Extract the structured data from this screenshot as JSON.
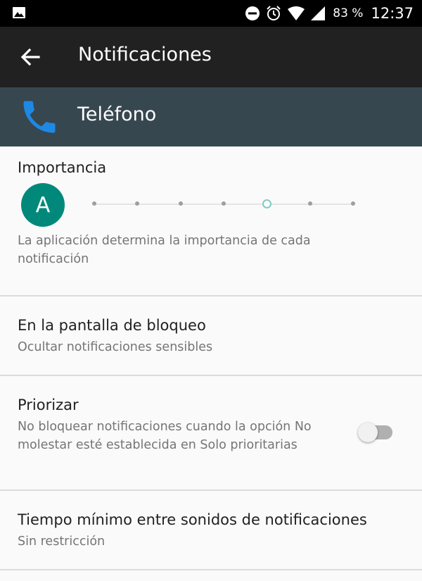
{
  "status_bar": {
    "battery_percent": "83 %",
    "time": "12:37",
    "icons": [
      "gallery-icon",
      "dnd-icon",
      "alarm-icon",
      "wifi-icon",
      "signal-icon"
    ]
  },
  "app_bar": {
    "title": "Notificaciones",
    "back_icon": "arrow-back-icon"
  },
  "app_header": {
    "name": "Teléfono",
    "icon": "phone-icon",
    "icon_color": "#1e88e5"
  },
  "importance": {
    "title": "Importancia",
    "avatar_letter": "A",
    "level": "5 of 7",
    "description": "La aplicación determina la importancia de cada notificación"
  },
  "lockscreen": {
    "title": "En la pantalla de bloqueo",
    "value": "Ocultar notificaciones sensibles"
  },
  "priority": {
    "title": "Priorizar",
    "description": "No bloquear notificaciones cuando la opción No molestar esté establecida en Solo prioritarias",
    "enabled": false
  },
  "min_time": {
    "title": "Tiempo mínimo entre sonidos de notificaciones",
    "value": "Sin restricción"
  },
  "colors": {
    "accent": "#00897b",
    "app_bar": "#212121",
    "header": "#37474f"
  }
}
